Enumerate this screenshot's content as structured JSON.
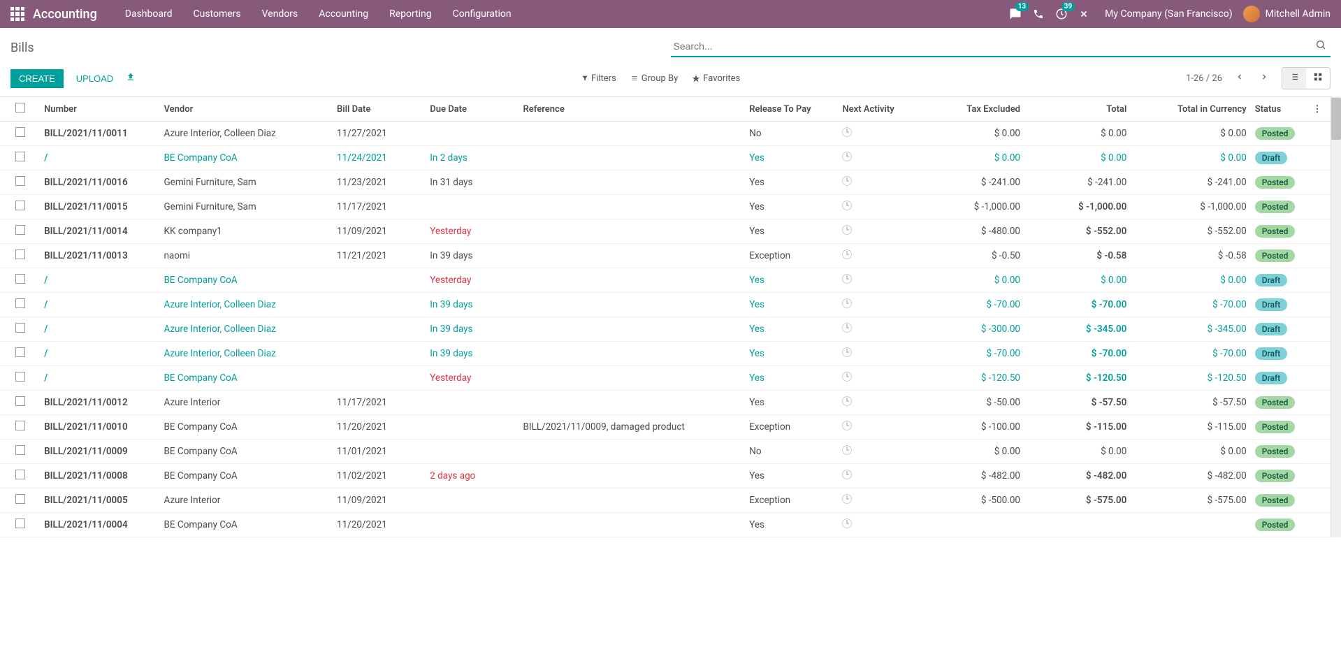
{
  "topnav": {
    "brand": "Accounting",
    "menu": [
      "Dashboard",
      "Customers",
      "Vendors",
      "Accounting",
      "Reporting",
      "Configuration"
    ],
    "chat_badge": "13",
    "activity_badge": "39",
    "company": "My Company (San Francisco)",
    "user": "Mitchell Admin"
  },
  "cp": {
    "title": "Bills",
    "search_placeholder": "Search...",
    "create": "CREATE",
    "upload": "UPLOAD",
    "filters": "Filters",
    "groupby": "Group By",
    "favorites": "Favorites",
    "pager": "1-26 / 26"
  },
  "columns": {
    "number": "Number",
    "vendor": "Vendor",
    "billdate": "Bill Date",
    "duedate": "Due Date",
    "reference": "Reference",
    "release": "Release To Pay",
    "next": "Next Activity",
    "tax": "Tax Excluded",
    "total": "Total",
    "totalcurr": "Total in Currency",
    "status": "Status"
  },
  "rows": [
    {
      "number": "BILL/2021/11/0011",
      "vendor": "Azure Interior, Colleen Diaz",
      "billdate": "11/27/2021",
      "duedate": "",
      "reference": "",
      "release": "No",
      "tax": "$ 0.00",
      "total": "$ 0.00",
      "totalcurr": "$ 0.00",
      "status": "Posted",
      "draft": false,
      "due_red": false,
      "total_bold": false
    },
    {
      "number": "/",
      "vendor": "BE Company CoA",
      "billdate": "11/24/2021",
      "duedate": "In 2 days",
      "reference": "",
      "release": "Yes",
      "tax": "$ 0.00",
      "total": "$ 0.00",
      "totalcurr": "$ 0.00",
      "status": "Draft",
      "draft": true,
      "due_red": false,
      "total_bold": false
    },
    {
      "number": "BILL/2021/11/0016",
      "vendor": "Gemini Furniture, Sam",
      "billdate": "11/23/2021",
      "duedate": "In 31 days",
      "reference": "",
      "release": "Yes",
      "tax": "$ -241.00",
      "total": "$ -241.00",
      "totalcurr": "$ -241.00",
      "status": "Posted",
      "draft": false,
      "due_red": false,
      "total_bold": false
    },
    {
      "number": "BILL/2021/11/0015",
      "vendor": "Gemini Furniture, Sam",
      "billdate": "11/17/2021",
      "duedate": "",
      "reference": "",
      "release": "Yes",
      "tax": "$ -1,000.00",
      "total": "$ -1,000.00",
      "totalcurr": "$ -1,000.00",
      "status": "Posted",
      "draft": false,
      "due_red": false,
      "total_bold": true
    },
    {
      "number": "BILL/2021/11/0014",
      "vendor": "KK company1",
      "billdate": "11/09/2021",
      "duedate": "Yesterday",
      "reference": "",
      "release": "Yes",
      "tax": "$ -480.00",
      "total": "$ -552.00",
      "totalcurr": "$ -552.00",
      "status": "Posted",
      "draft": false,
      "due_red": true,
      "total_bold": true
    },
    {
      "number": "BILL/2021/11/0013",
      "vendor": "naomi",
      "billdate": "11/21/2021",
      "duedate": "In 39 days",
      "reference": "",
      "release": "Exception",
      "tax": "$ -0.50",
      "total": "$ -0.58",
      "totalcurr": "$ -0.58",
      "status": "Posted",
      "draft": false,
      "due_red": false,
      "total_bold": true
    },
    {
      "number": "/",
      "vendor": "BE Company CoA",
      "billdate": "",
      "duedate": "Yesterday",
      "reference": "",
      "release": "Yes",
      "tax": "$ 0.00",
      "total": "$ 0.00",
      "totalcurr": "$ 0.00",
      "status": "Draft",
      "draft": true,
      "due_red": true,
      "total_bold": false
    },
    {
      "number": "/",
      "vendor": "Azure Interior, Colleen Diaz",
      "billdate": "",
      "duedate": "In 39 days",
      "reference": "",
      "release": "Yes",
      "tax": "$ -70.00",
      "total": "$ -70.00",
      "totalcurr": "$ -70.00",
      "status": "Draft",
      "draft": true,
      "due_red": false,
      "total_bold": true
    },
    {
      "number": "/",
      "vendor": "Azure Interior, Colleen Diaz",
      "billdate": "",
      "duedate": "In 39 days",
      "reference": "",
      "release": "Yes",
      "tax": "$ -300.00",
      "total": "$ -345.00",
      "totalcurr": "$ -345.00",
      "status": "Draft",
      "draft": true,
      "due_red": false,
      "total_bold": true
    },
    {
      "number": "/",
      "vendor": "Azure Interior, Colleen Diaz",
      "billdate": "",
      "duedate": "In 39 days",
      "reference": "",
      "release": "Yes",
      "tax": "$ -70.00",
      "total": "$ -70.00",
      "totalcurr": "$ -70.00",
      "status": "Draft",
      "draft": true,
      "due_red": false,
      "total_bold": true
    },
    {
      "number": "/",
      "vendor": "BE Company CoA",
      "billdate": "",
      "duedate": "Yesterday",
      "reference": "",
      "release": "Yes",
      "tax": "$ -120.50",
      "total": "$ -120.50",
      "totalcurr": "$ -120.50",
      "status": "Draft",
      "draft": true,
      "due_red": true,
      "total_bold": true
    },
    {
      "number": "BILL/2021/11/0012",
      "vendor": "Azure Interior",
      "billdate": "11/17/2021",
      "duedate": "",
      "reference": "",
      "release": "Yes",
      "tax": "$ -50.00",
      "total": "$ -57.50",
      "totalcurr": "$ -57.50",
      "status": "Posted",
      "draft": false,
      "due_red": false,
      "total_bold": true
    },
    {
      "number": "BILL/2021/11/0010",
      "vendor": "BE Company CoA",
      "billdate": "11/20/2021",
      "duedate": "",
      "reference": "BILL/2021/11/0009, damaged product",
      "release": "Exception",
      "tax": "$ -100.00",
      "total": "$ -115.00",
      "totalcurr": "$ -115.00",
      "status": "Posted",
      "draft": false,
      "due_red": false,
      "total_bold": true
    },
    {
      "number": "BILL/2021/11/0009",
      "vendor": "BE Company CoA",
      "billdate": "11/01/2021",
      "duedate": "",
      "reference": "",
      "release": "No",
      "tax": "$ 0.00",
      "total": "$ 0.00",
      "totalcurr": "$ 0.00",
      "status": "Posted",
      "draft": false,
      "due_red": false,
      "total_bold": false
    },
    {
      "number": "BILL/2021/11/0008",
      "vendor": "BE Company CoA",
      "billdate": "11/02/2021",
      "duedate": "2 days ago",
      "reference": "",
      "release": "Yes",
      "tax": "$ -482.00",
      "total": "$ -482.00",
      "totalcurr": "$ -482.00",
      "status": "Posted",
      "draft": false,
      "due_red": true,
      "total_bold": true
    },
    {
      "number": "BILL/2021/11/0005",
      "vendor": "Azure Interior",
      "billdate": "11/09/2021",
      "duedate": "",
      "reference": "",
      "release": "Exception",
      "tax": "$ -500.00",
      "total": "$ -575.00",
      "totalcurr": "$ -575.00",
      "status": "Posted",
      "draft": false,
      "due_red": false,
      "total_bold": true
    },
    {
      "number": "BILL/2021/11/0004",
      "vendor": "BE Company CoA",
      "billdate": "11/20/2021",
      "duedate": "",
      "reference": "",
      "release": "Yes",
      "tax": "",
      "total": "",
      "totalcurr": "",
      "status": "Posted",
      "draft": false,
      "due_red": false,
      "total_bold": false
    }
  ]
}
